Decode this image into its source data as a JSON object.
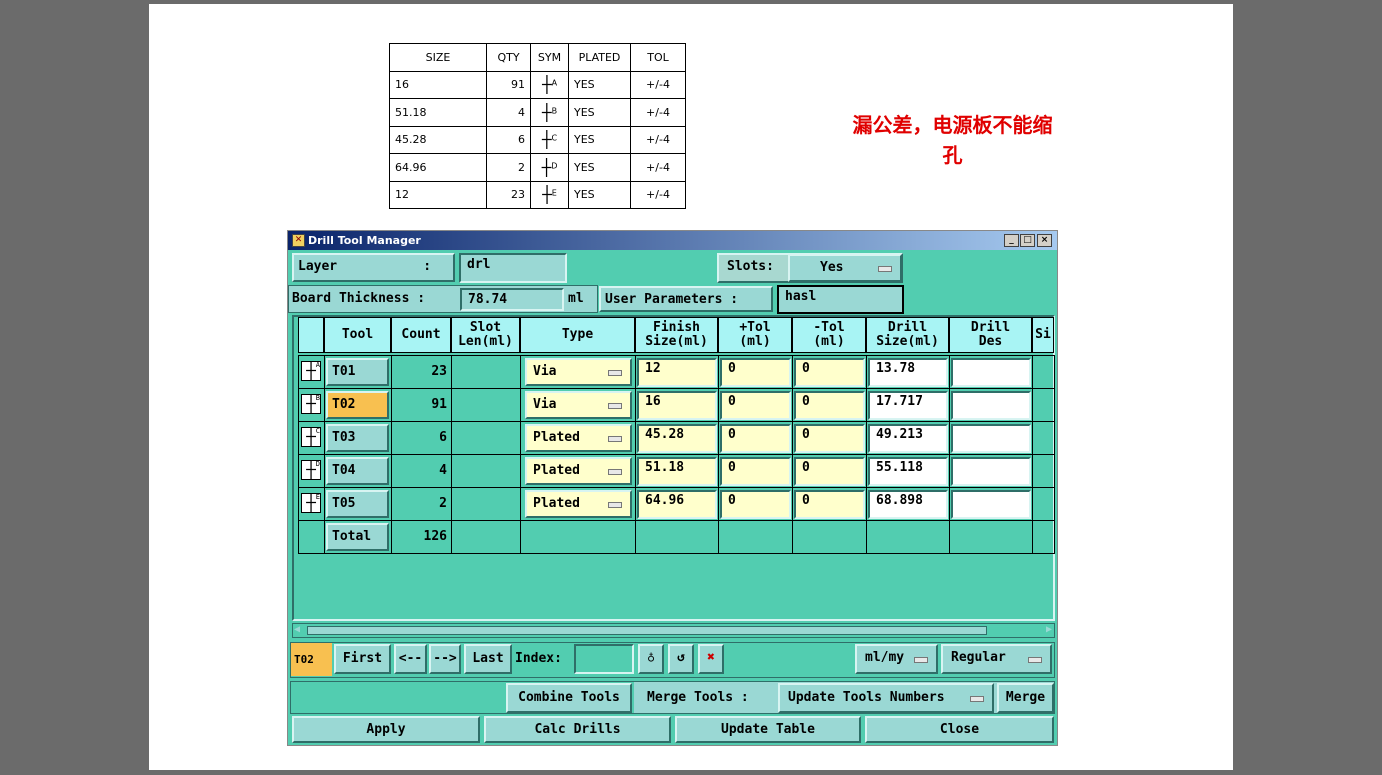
{
  "spec_table": {
    "headers": [
      "SIZE",
      "QTY",
      "SYM",
      "PLATED",
      "TOL"
    ],
    "rows": [
      [
        "16",
        "91",
        "A",
        "YES",
        "+/-4"
      ],
      [
        "51.18",
        "4",
        "B",
        "YES",
        "+/-4"
      ],
      [
        "45.28",
        "6",
        "C",
        "YES",
        "+/-4"
      ],
      [
        "64.96",
        "2",
        "D",
        "YES",
        "+/-4"
      ],
      [
        "12",
        "23",
        "E",
        "YES",
        "+/-4"
      ]
    ]
  },
  "note": {
    "line1": "漏公差，电源板不能缩",
    "line2": "孔"
  },
  "window": {
    "title": "Drill Tool Manager",
    "min": "_",
    "max": "□",
    "close": "×"
  },
  "form": {
    "layer_label": "Layer           :",
    "layer_value": "drl",
    "slots_label": "Slots:",
    "slots_value": "Yes",
    "thickness_label": "Board Thickness :",
    "thickness_value": "78.74",
    "thickness_unit": "ml",
    "user_params_label": "User Parameters :",
    "user_params_value": "hasl"
  },
  "grid": {
    "headers": [
      "",
      "Tool",
      "Count",
      "Slot\nLen(ml)",
      "Type",
      "Finish\nSize(ml)",
      "+Tol\n(ml)",
      "-Tol\n(ml)",
      "Drill\nSize(ml)",
      "Drill\nDes",
      "Si"
    ],
    "rows": [
      {
        "sym": "A",
        "tool": "T01",
        "count": "23",
        "type": "Via",
        "finish": "12",
        "ptol": "0",
        "mtol": "0",
        "drill": "13.78",
        "des": ""
      },
      {
        "sym": "B",
        "tool": "T02",
        "count": "91",
        "type": "Via",
        "finish": "16",
        "ptol": "0",
        "mtol": "0",
        "drill": "17.717",
        "des": "",
        "selected": true
      },
      {
        "sym": "C",
        "tool": "T03",
        "count": "6",
        "type": "Plated",
        "finish": "45.28",
        "ptol": "0",
        "mtol": "0",
        "drill": "49.213",
        "des": ""
      },
      {
        "sym": "D",
        "tool": "T04",
        "count": "4",
        "type": "Plated",
        "finish": "51.18",
        "ptol": "0",
        "mtol": "0",
        "drill": "55.118",
        "des": ""
      },
      {
        "sym": "E",
        "tool": "T05",
        "count": "2",
        "type": "Plated",
        "finish": "64.96",
        "ptol": "0",
        "mtol": "0",
        "drill": "68.898",
        "des": ""
      }
    ],
    "total_label": "Total",
    "total_count": "126"
  },
  "nav": {
    "current": "T02",
    "first": "First",
    "prev": "<--",
    "next": "-->",
    "last": "Last",
    "index_label": "Index:",
    "index_value": "",
    "units": "ml/my",
    "mode": "Regular"
  },
  "actions": {
    "combine": "Combine Tools",
    "merge_label": "Merge Tools :",
    "merge_option": "Update Tools Numbers",
    "merge": "Merge",
    "apply": "Apply",
    "calc": "Calc Drills",
    "update": "Update Table",
    "close": "Close"
  },
  "colors": {
    "panel": "#52cdb0",
    "button": "#9ad8d4",
    "header": "#a8f4f4",
    "input": "#ffffcc",
    "selected": "#f8c050"
  }
}
